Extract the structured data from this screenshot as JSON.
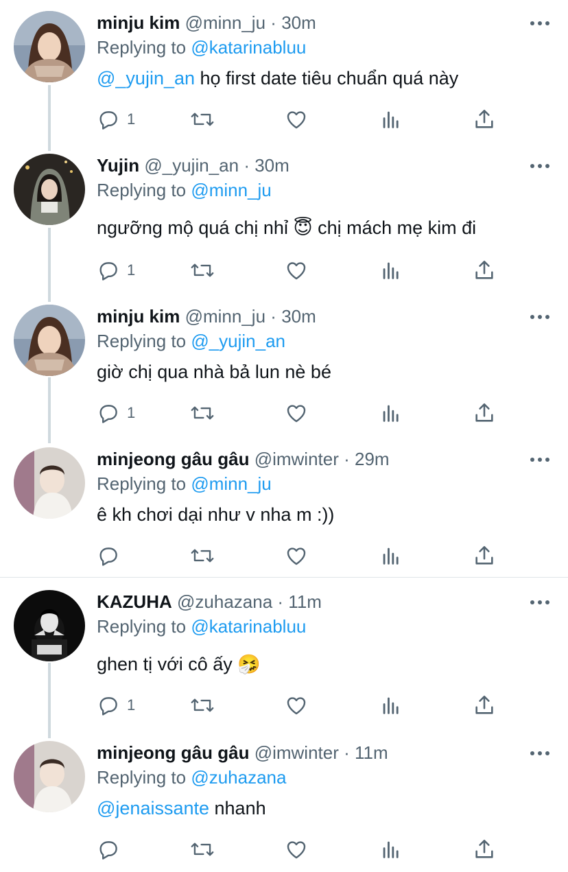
{
  "tweets": [
    {
      "name": "minju kim",
      "handle": "@minn_ju",
      "time": "30m",
      "replying_prefix": "Replying to",
      "replying_to": "@katarinabluu",
      "text_mention": "@_yujin_an",
      "text": " họ first date tiêu chuẩn quá này",
      "reply_count": "1"
    },
    {
      "name": "Yujin",
      "handle": "@_yujin_an",
      "time": "30m",
      "replying_prefix": "Replying to",
      "replying_to": "@minn_ju",
      "text": "ngưỡng mộ quá chị nhỉ 😇  chị mách mẹ kim đi",
      "reply_count": "1"
    },
    {
      "name": "minju kim",
      "handle": "@minn_ju",
      "time": "30m",
      "replying_prefix": "Replying to",
      "replying_to": "@_yujin_an",
      "text": "giờ chị qua nhà bả lun nè bé",
      "reply_count": "1"
    },
    {
      "name": "minjeong gâu gâu",
      "handle": "@imwinter",
      "time": "29m",
      "replying_prefix": "Replying to",
      "replying_to": "@minn_ju",
      "text": "ê kh chơi dại như v nha m :))",
      "reply_count": ""
    },
    {
      "name": "KAZUHA",
      "handle": "@zuhazana",
      "time": "11m",
      "replying_prefix": "Replying to",
      "replying_to": "@katarinabluu",
      "text": "ghen tị với cô ấy 🤧",
      "reply_count": "1"
    },
    {
      "name": "minjeong gâu gâu",
      "handle": "@imwinter",
      "time": "11m",
      "replying_prefix": "Replying to",
      "replying_to": "@zuhazana",
      "text_mention": "@jenaissante",
      "text": " nhanh",
      "reply_count": ""
    }
  ],
  "separator": "·",
  "icons": [
    "reply-icon",
    "retweet-icon",
    "like-icon",
    "analytics-icon",
    "share-icon",
    "more-icon"
  ],
  "colors": {
    "mention": "#1d9bf0",
    "secondary": "#536471",
    "thread_line": "#cfd9de"
  }
}
